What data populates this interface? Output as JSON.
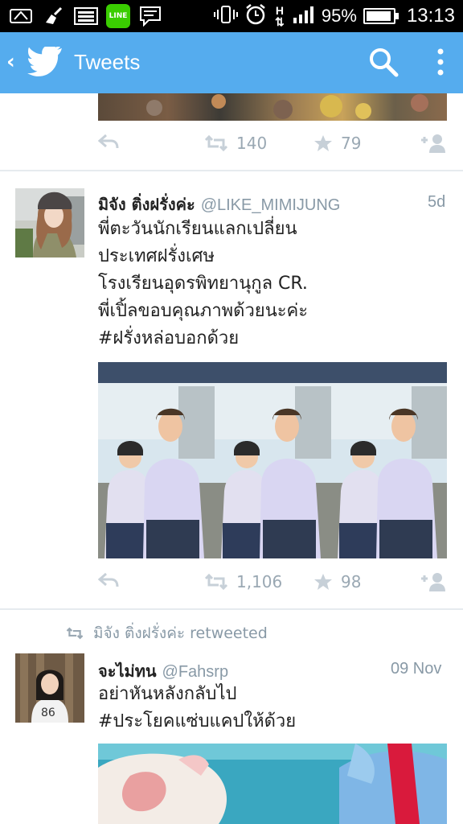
{
  "status_bar": {
    "battery": "95%",
    "time": "13:13",
    "battery_level": 0.95,
    "network": "H"
  },
  "header": {
    "title": "Tweets"
  },
  "tweets": [
    {
      "retweets": "140",
      "favorites": "79"
    },
    {
      "name": "มิจัง ติ่งฝรั่งค่ะ",
      "handle": "@LIKE_MIMIJUNG",
      "time": "5d",
      "lines": [
        "พี่ตะวันนักเรียนแลกเปลี่ยน",
        "ประเทศฝรั่งเศษ",
        "โรงเรียนอุดรพิทยานุกูล  CR.",
        "พี่เปิ้ลขอบคุณภาพด้วยนะค่ะ",
        "#ฝรั่งหล่อบอกด้วย"
      ],
      "retweets": "1,106",
      "favorites": "98"
    },
    {
      "retweeted_by": "มิจัง ติ่งฝรั่งค่ะ retweeted",
      "name": "จะไม่ทน",
      "handle": "@Fahsrp",
      "time": "09 Nov",
      "lines": [
        "อย่าหันหลังกลับไป",
        "#ประโยคแซ่บแคปให้ด้วย"
      ]
    }
  ],
  "colors": {
    "brand": "#55acee",
    "muted": "#8899a6"
  }
}
